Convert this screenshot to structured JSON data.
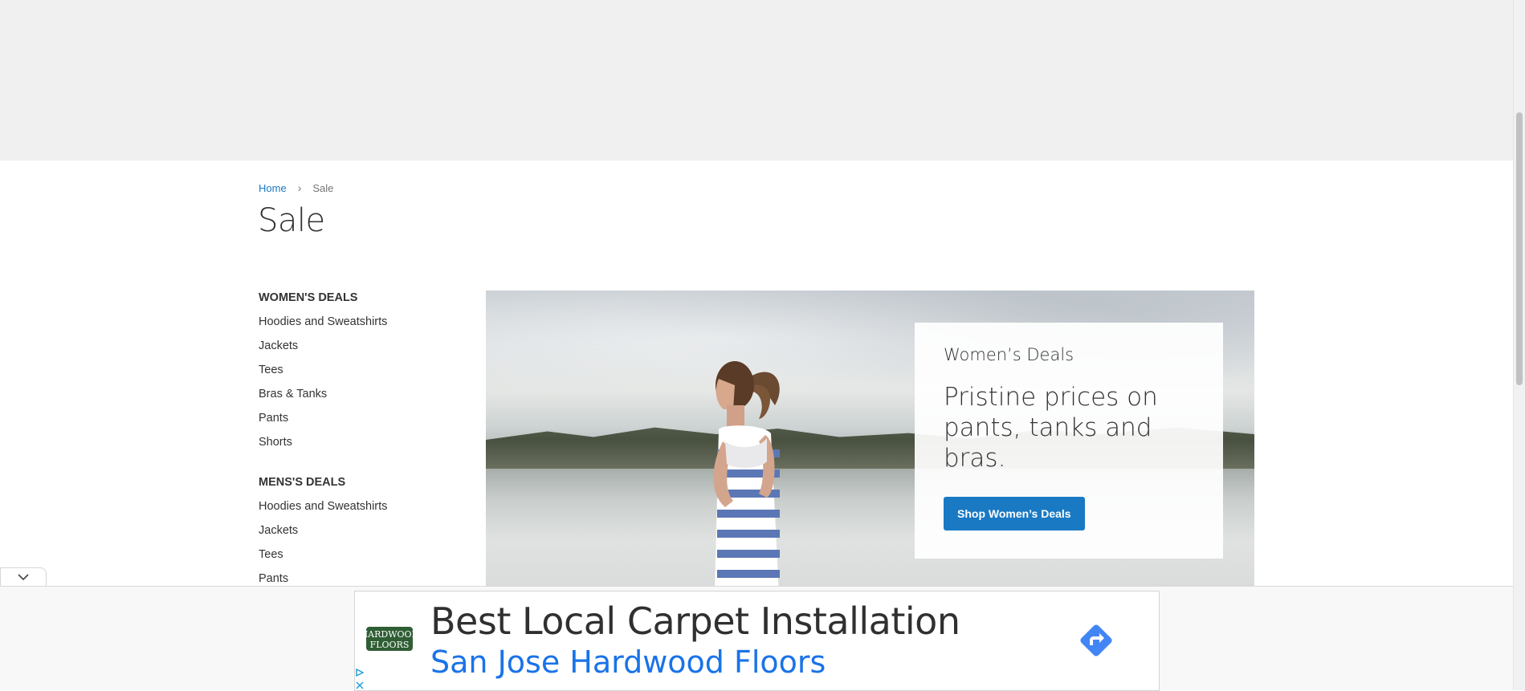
{
  "breadcrumb": {
    "home": "Home",
    "separator": "›",
    "current": "Sale"
  },
  "page_title": "Sale",
  "sidebar": {
    "womens": {
      "heading": "WOMEN'S DEALS",
      "items": [
        "Hoodies and Sweatshirts",
        "Jackets",
        "Tees",
        "Bras & Tanks",
        "Pants",
        "Shorts"
      ]
    },
    "mens": {
      "heading": "MENS'S DEALS",
      "items": [
        "Hoodies and Sweatshirts",
        "Jackets",
        "Tees",
        "Pants"
      ]
    }
  },
  "hero": {
    "eyebrow": "Women’s Deals",
    "headline": "Pristine prices on pants, tanks and bras.",
    "cta_label": "Shop Women’s Deals",
    "accent_color": "#1979c3"
  },
  "ad": {
    "title": "Best Local Carpet Installation",
    "subtitle": "San Jose Hardwood Floors",
    "logo_line1": "HARDWOOD",
    "logo_line2": "FLOORS",
    "icons": [
      "chevron-down-icon",
      "directions-arrow-icon",
      "adchoices-icon",
      "close-icon"
    ]
  }
}
